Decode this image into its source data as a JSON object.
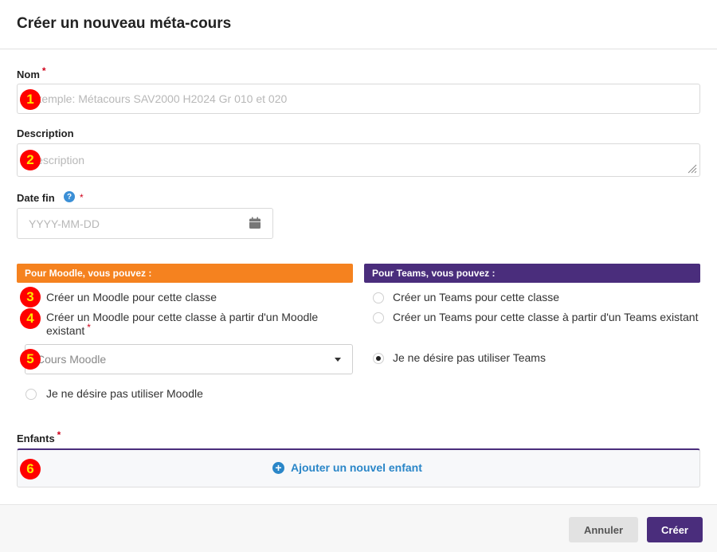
{
  "dialog": {
    "title": "Créer un nouveau méta-cours"
  },
  "fields": {
    "name": {
      "label": "Nom",
      "required_mark": "*",
      "placeholder": "Exemple: Métacours SAV2000 H2024 Gr 010 et 020",
      "value": ""
    },
    "description": {
      "label": "Description",
      "placeholder": "Description",
      "value": ""
    },
    "end_date": {
      "label": "Date fin",
      "required_mark": "*",
      "help_glyph": "?",
      "placeholder": "YYYY-MM-DD",
      "value": ""
    }
  },
  "moodle": {
    "header": "Pour Moodle, vous pouvez :",
    "header_color": "#f5821f",
    "options": [
      {
        "label": "Créer un Moodle pour cette classe",
        "checked": false
      },
      {
        "label": "Créer un Moodle pour cette classe à partir d'un Moodle existant",
        "checked": false,
        "required_mark": "*"
      },
      {
        "label": "Je ne désire pas utiliser Moodle",
        "checked": false
      }
    ],
    "select_placeholder": "Cours Moodle"
  },
  "teams": {
    "header": "Pour Teams, vous pouvez :",
    "header_color": "#4a2d7c",
    "options": [
      {
        "label": "Créer un Teams pour cette classe",
        "checked": false
      },
      {
        "label": "Créer un Teams pour cette classe à partir d'un Teams existant",
        "checked": false
      },
      {
        "label": "Je ne désire pas utiliser Teams",
        "checked": true
      }
    ]
  },
  "children": {
    "label": "Enfants",
    "required_mark": "*",
    "add_label": "Ajouter un nouvel enfant",
    "add_glyph": "+"
  },
  "footer": {
    "cancel_label": "Annuler",
    "create_label": "Créer",
    "primary_color": "#4a2d7c"
  },
  "annotations": [
    "1",
    "2",
    "3",
    "4",
    "5",
    "6"
  ],
  "icons": {
    "calendar": "calendar-icon",
    "help": "help-icon",
    "caret": "chevron-down-icon",
    "add": "plus-circle-icon",
    "resize": "resize-grip-icon"
  }
}
